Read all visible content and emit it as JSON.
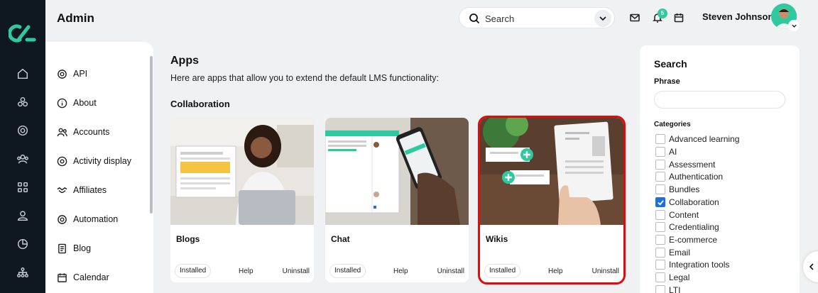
{
  "header": {
    "title": "Admin",
    "search_placeholder": "Search",
    "notification_count": "5",
    "user_name": "Steven Johnson"
  },
  "sidebar": {
    "items": [
      {
        "label": "API",
        "icon": "gear-icon"
      },
      {
        "label": "About",
        "icon": "info-icon"
      },
      {
        "label": "Accounts",
        "icon": "users-icon"
      },
      {
        "label": "Activity display",
        "icon": "target-icon"
      },
      {
        "label": "Affiliates",
        "icon": "handshake-icon"
      },
      {
        "label": "Automation",
        "icon": "gear-icon"
      },
      {
        "label": "Blog",
        "icon": "document-icon"
      },
      {
        "label": "Calendar",
        "icon": "calendar-icon"
      }
    ]
  },
  "main": {
    "heading": "Apps",
    "intro": "Here are apps that allow you to extend the default LMS functionality:",
    "section": "Collaboration",
    "cards": [
      {
        "title": "Blogs",
        "status": "Installed",
        "help": "Help",
        "uninstall": "Uninstall"
      },
      {
        "title": "Chat",
        "status": "Installed",
        "help": "Help",
        "uninstall": "Uninstall"
      },
      {
        "title": "Wikis",
        "status": "Installed",
        "help": "Help",
        "uninstall": "Uninstall"
      }
    ]
  },
  "filter": {
    "title": "Search",
    "phrase_label": "Phrase",
    "categories_label": "Categories",
    "categories": [
      {
        "label": "Advanced learning",
        "checked": false
      },
      {
        "label": "AI",
        "checked": false
      },
      {
        "label": "Assessment",
        "checked": false
      },
      {
        "label": "Authentication",
        "checked": false
      },
      {
        "label": "Bundles",
        "checked": false
      },
      {
        "label": "Collaboration",
        "checked": true
      },
      {
        "label": "Content",
        "checked": false
      },
      {
        "label": "Credentialing",
        "checked": false
      },
      {
        "label": "E-commerce",
        "checked": false
      },
      {
        "label": "Email",
        "checked": false
      },
      {
        "label": "Integration tools",
        "checked": false
      },
      {
        "label": "Legal",
        "checked": false
      },
      {
        "label": "LTI",
        "checked": false
      }
    ]
  },
  "colors": {
    "rail": "#0f1720",
    "accent": "#2fc9a0",
    "selection_outline": "#e00c0c",
    "checkbox_checked": "#1e6fd9"
  }
}
